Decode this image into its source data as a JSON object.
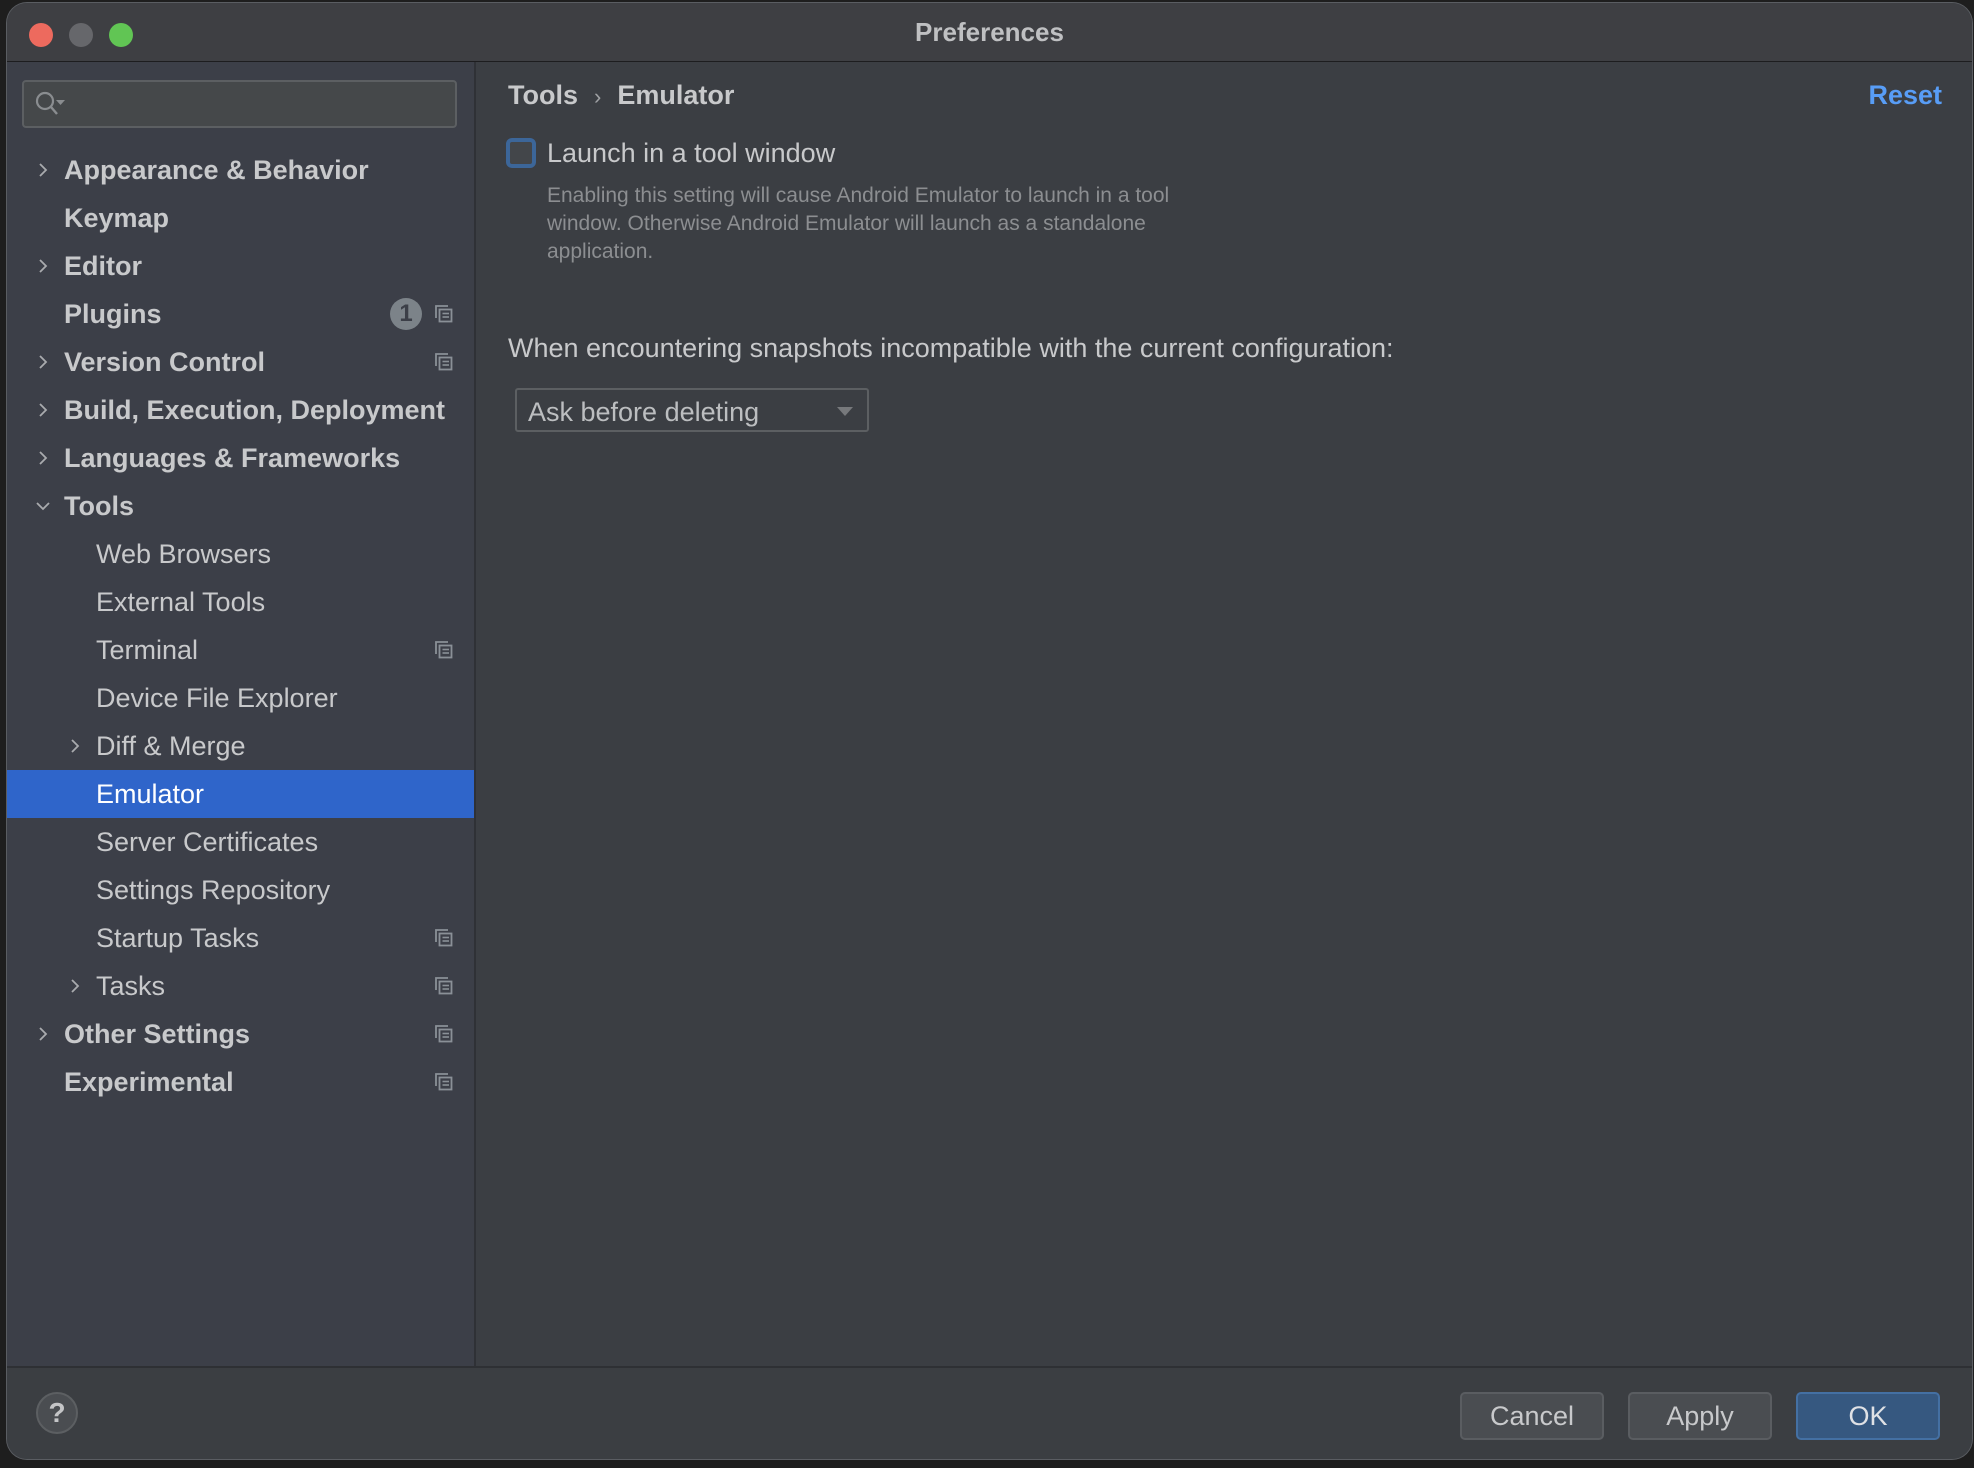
{
  "window": {
    "title": "Preferences"
  },
  "search": {
    "placeholder": "",
    "value": ""
  },
  "sidebar": {
    "items": [
      {
        "label": "Appearance & Behavior",
        "level": 0,
        "expandable": true,
        "expanded": false
      },
      {
        "label": "Keymap",
        "level": 0,
        "expandable": false
      },
      {
        "label": "Editor",
        "level": 0,
        "expandable": true,
        "expanded": false
      },
      {
        "label": "Plugins",
        "level": 0,
        "expandable": false,
        "badge": "1",
        "project_icon": true
      },
      {
        "label": "Version Control",
        "level": 0,
        "expandable": true,
        "expanded": false,
        "project_icon": true
      },
      {
        "label": "Build, Execution, Deployment",
        "level": 0,
        "expandable": true,
        "expanded": false
      },
      {
        "label": "Languages & Frameworks",
        "level": 0,
        "expandable": true,
        "expanded": false
      },
      {
        "label": "Tools",
        "level": 0,
        "expandable": true,
        "expanded": true
      },
      {
        "label": "Web Browsers",
        "level": 1,
        "expandable": false
      },
      {
        "label": "External Tools",
        "level": 1,
        "expandable": false
      },
      {
        "label": "Terminal",
        "level": 1,
        "expandable": false,
        "project_icon": true
      },
      {
        "label": "Device File Explorer",
        "level": 1,
        "expandable": false
      },
      {
        "label": "Diff & Merge",
        "level": 1,
        "expandable": true,
        "expanded": false
      },
      {
        "label": "Emulator",
        "level": 1,
        "expandable": false,
        "selected": true
      },
      {
        "label": "Server Certificates",
        "level": 1,
        "expandable": false
      },
      {
        "label": "Settings Repository",
        "level": 1,
        "expandable": false
      },
      {
        "label": "Startup Tasks",
        "level": 1,
        "expandable": false,
        "project_icon": true
      },
      {
        "label": "Tasks",
        "level": 1,
        "expandable": true,
        "expanded": false,
        "project_icon": true
      },
      {
        "label": "Other Settings",
        "level": 0,
        "expandable": true,
        "expanded": false,
        "project_icon": true
      },
      {
        "label": "Experimental",
        "level": 0,
        "expandable": false,
        "project_icon": true
      }
    ]
  },
  "main": {
    "breadcrumb": [
      "Tools",
      "Emulator"
    ],
    "breadcrumb_separator": "›",
    "reset_label": "Reset",
    "launch_checkbox": {
      "label": "Launch in a tool window",
      "checked": false,
      "description": "Enabling this setting will cause Android Emulator to launch in a tool window. Otherwise Android Emulator will launch as a standalone application."
    },
    "snapshot_label": "When encountering snapshots incompatible with the current configuration:",
    "snapshot_dropdown": {
      "selected": "Ask before deleting"
    }
  },
  "footer": {
    "help_label": "?",
    "cancel_label": "Cancel",
    "apply_label": "Apply",
    "ok_label": "OK"
  },
  "colors": {
    "selection": "#2f65ca",
    "link": "#589df6",
    "primary_button": "#365880",
    "checkbox_focus": "#3c6699",
    "close": "#ed6a5e",
    "minimize": "#66676b",
    "zoom": "#61c554"
  }
}
